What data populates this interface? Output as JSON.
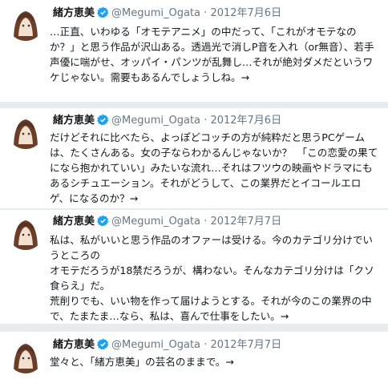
{
  "tweets": [
    {
      "name": "緒方恵美",
      "handle": "@Megumi_Ogata",
      "dot": "·",
      "date": "2012年7月6日",
      "text": "…正直、いわゆる「オモテアニメ」の中だって、「これがオモテなのか？」と思う作品が沢山ある。透過光で消しP音を入れ（or無音）、若手声優に喘がせ、オッパイ・パンツが乱舞し…それが絶対ダメだというワケじゃない。需要もあるんでしょうしね。→"
    },
    {
      "name": "緒方恵美",
      "handle": "@Megumi_Ogata",
      "dot": "·",
      "date": "2012年7月6日",
      "text": "だけどそれに比べたら、よっぽどコッチの方が純粋だと思うPCゲームは、たくさんある。女の子ならわかるんじゃないか？　「この恋愛の果てになら抱かれていい」みたいな流れ…それはフツウの映画やドラマにもあるシチュエーション。それがどうして、この業界だとイコールエロゲ、になるのか？→"
    },
    {
      "name": "緒方恵美",
      "handle": "@Megumi_Ogata",
      "dot": "·",
      "date": "2012年7月7日",
      "text": "私は、私がいいと思う作品のオファーは受ける。今のカテゴリ分けでいうところの\nオモテだろうが18禁だろうが、構わない。そんなカテゴリ分けは「クソ食らえ」だ。\n荒削りでも、いい物を作って届けようとする。それが今のこの業界の中で、たまたま…なら、私は、喜んで仕事をしたい。→"
    },
    {
      "name": "緒方恵美",
      "handle": "@Megumi_Ogata",
      "dot": "·",
      "date": "2012年7月7日",
      "text": "堂々と、「緒方恵美」の芸名のままで。→"
    }
  ],
  "colors": {
    "verified": "#1da1f2",
    "secondary_text": "#657786",
    "separator": "#e6ecf0"
  }
}
